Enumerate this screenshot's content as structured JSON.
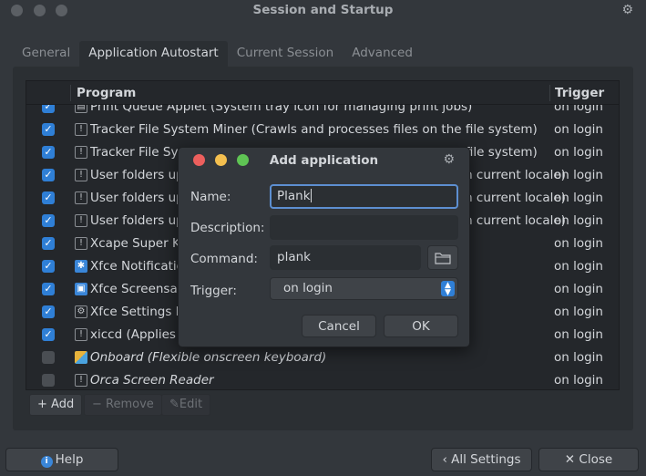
{
  "window": {
    "title": "Session and Startup"
  },
  "tabs": [
    {
      "label": "General"
    },
    {
      "label": "Application Autostart"
    },
    {
      "label": "Current Session"
    },
    {
      "label": "Advanced"
    }
  ],
  "list": {
    "header_program": "Program",
    "header_trigger": "Trigger",
    "rows": [
      {
        "checked": true,
        "icon": "printer-icon",
        "text": "Print Queue Applet (System tray icon for managing print jobs)",
        "trigger": "on login",
        "italic": false
      },
      {
        "checked": true,
        "icon": "generic-app-icon",
        "text": "Tracker File System Miner (Crawls and processes files on the file system)",
        "trigger": "on login",
        "italic": false
      },
      {
        "checked": true,
        "icon": "generic-app-icon",
        "text": "Tracker File System Miner (Crawls and processes files on the file system)",
        "trigger": "on login",
        "italic": false
      },
      {
        "checked": true,
        "icon": "generic-app-icon",
        "text": "User folders update (Update common folders names to match current locale)",
        "trigger": "on login",
        "italic": false
      },
      {
        "checked": true,
        "icon": "generic-app-icon",
        "text": "User folders update (Update common folders names to match current locale)",
        "trigger": "on login",
        "italic": false
      },
      {
        "checked": true,
        "icon": "generic-app-icon",
        "text": "User folders update (Update common folders names to match current locale)",
        "trigger": "on login",
        "italic": false
      },
      {
        "checked": true,
        "icon": "generic-app-icon",
        "text": "Xcape Super Key",
        "trigger": "on login",
        "italic": false
      },
      {
        "checked": true,
        "icon": "xfce-notification-icon",
        "text": "Xfce Notification Daemon",
        "trigger": "on login",
        "italic": false
      },
      {
        "checked": true,
        "icon": "xfce-screensaver-icon",
        "text": "Xfce Screensaver",
        "trigger": "on login",
        "italic": false
      },
      {
        "checked": true,
        "icon": "settings-gear-icon",
        "text": "Xfce Settings Daemon",
        "trigger": "on login",
        "italic": false
      },
      {
        "checked": true,
        "icon": "generic-app-icon",
        "text": "xiccd (Applies color profiles)",
        "trigger": "on login",
        "italic": false
      },
      {
        "checked": false,
        "icon": "onboard-keyboard-icon",
        "text": "Onboard (Flexible onscreen keyboard)",
        "trigger": "on login",
        "italic": true
      },
      {
        "checked": false,
        "icon": "generic-app-icon",
        "text": "Orca Screen Reader",
        "trigger": "on login",
        "italic": true
      }
    ]
  },
  "list_toolbar": {
    "add": "Add",
    "remove": "Remove",
    "edit": "Edit"
  },
  "dialog": {
    "title": "Add application",
    "name_label": "Name:",
    "name_value": "Plank",
    "description_label": "Description:",
    "description_value": "",
    "command_label": "Command:",
    "command_value": "plank",
    "trigger_label": "Trigger:",
    "trigger_value": "on login",
    "cancel": "Cancel",
    "ok": "OK"
  },
  "footer": {
    "help": "Help",
    "all_settings": "All Settings",
    "close": "Close"
  },
  "colors": {
    "accent": "#2f7fd6",
    "close_dot": "#ec5f5d",
    "min_dot": "#f4bf4f",
    "max_dot": "#5fc454"
  }
}
